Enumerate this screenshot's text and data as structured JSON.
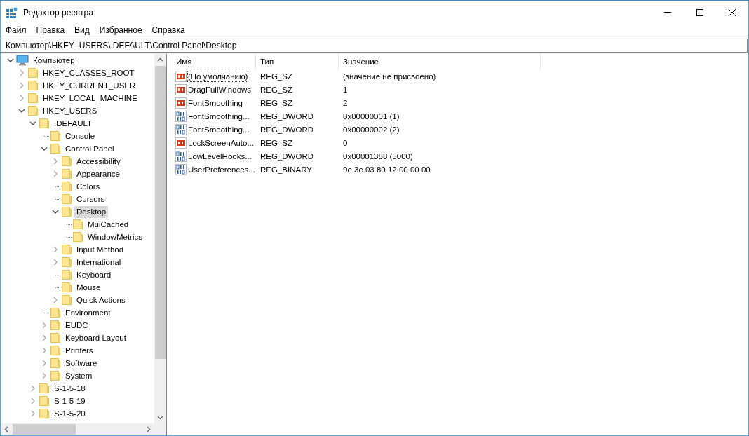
{
  "window": {
    "title": "Редактор реестра"
  },
  "menu": [
    "Файл",
    "Правка",
    "Вид",
    "Избранное",
    "Справка"
  ],
  "address": "Компьютер\\HKEY_USERS\\.DEFAULT\\Control Panel\\Desktop",
  "tree": {
    "name": "Компьютер",
    "expandable": true,
    "expanded": true,
    "selected": false,
    "children": [
      {
        "name": "HKEY_CLASSES_ROOT",
        "expandable": true,
        "expanded": false,
        "selected": false
      },
      {
        "name": "HKEY_CURRENT_USER",
        "expandable": true,
        "expanded": false,
        "selected": false
      },
      {
        "name": "HKEY_LOCAL_MACHINE",
        "expandable": true,
        "expanded": false,
        "selected": false
      },
      {
        "name": "HKEY_USERS",
        "expandable": true,
        "expanded": true,
        "selected": false,
        "children": [
          {
            "name": ".DEFAULT",
            "expandable": true,
            "expanded": true,
            "selected": false,
            "children": [
              {
                "name": "Console",
                "expandable": false,
                "selected": false
              },
              {
                "name": "Control Panel",
                "expandable": true,
                "expanded": true,
                "selected": false,
                "children": [
                  {
                    "name": "Accessibility",
                    "expandable": true,
                    "expanded": false,
                    "selected": false
                  },
                  {
                    "name": "Appearance",
                    "expandable": true,
                    "expanded": false,
                    "selected": false
                  },
                  {
                    "name": "Colors",
                    "expandable": false,
                    "selected": false
                  },
                  {
                    "name": "Cursors",
                    "expandable": false,
                    "selected": false
                  },
                  {
                    "name": "Desktop",
                    "expandable": true,
                    "expanded": true,
                    "selected": true,
                    "children": [
                      {
                        "name": "MuiCached",
                        "expandable": false,
                        "selected": false
                      },
                      {
                        "name": "WindowMetrics",
                        "expandable": false,
                        "selected": false
                      }
                    ]
                  },
                  {
                    "name": "Input Method",
                    "expandable": true,
                    "expanded": false,
                    "selected": false
                  },
                  {
                    "name": "International",
                    "expandable": true,
                    "expanded": false,
                    "selected": false
                  },
                  {
                    "name": "Keyboard",
                    "expandable": false,
                    "selected": false
                  },
                  {
                    "name": "Mouse",
                    "expandable": false,
                    "selected": false
                  },
                  {
                    "name": "Quick Actions",
                    "expandable": true,
                    "expanded": false,
                    "selected": false
                  }
                ]
              },
              {
                "name": "Environment",
                "expandable": false,
                "selected": false
              },
              {
                "name": "EUDC",
                "expandable": true,
                "expanded": false,
                "selected": false
              },
              {
                "name": "Keyboard Layout",
                "expandable": true,
                "expanded": false,
                "selected": false
              },
              {
                "name": "Printers",
                "expandable": true,
                "expanded": false,
                "selected": false
              },
              {
                "name": "Software",
                "expandable": true,
                "expanded": false,
                "selected": false
              },
              {
                "name": "System",
                "expandable": true,
                "expanded": false,
                "selected": false
              }
            ]
          },
          {
            "name": "S-1-5-18",
            "expandable": true,
            "expanded": false,
            "selected": false
          },
          {
            "name": "S-1-5-19",
            "expandable": true,
            "expanded": false,
            "selected": false
          },
          {
            "name": "S-1-5-20",
            "expandable": true,
            "expanded": false,
            "selected": false
          }
        ]
      }
    ]
  },
  "table": {
    "columns": [
      "Имя",
      "Тип",
      "Значение"
    ],
    "rows": [
      {
        "kind": "string",
        "name": "(По умолчанию)",
        "type": "REG_SZ",
        "value": "(значение не присвоено)",
        "focused": true
      },
      {
        "kind": "string",
        "name": "DragFullWindows",
        "type": "REG_SZ",
        "value": "1",
        "focused": false
      },
      {
        "kind": "string",
        "name": "FontSmoothing",
        "type": "REG_SZ",
        "value": "2",
        "focused": false
      },
      {
        "kind": "binary",
        "name": "FontSmoothing...",
        "type": "REG_DWORD",
        "value": "0x00000001 (1)",
        "focused": false
      },
      {
        "kind": "binary",
        "name": "FontSmoothing...",
        "type": "REG_DWORD",
        "value": "0x00000002 (2)",
        "focused": false
      },
      {
        "kind": "string",
        "name": "LockScreenAuto...",
        "type": "REG_SZ",
        "value": "0",
        "focused": false
      },
      {
        "kind": "binary",
        "name": "LowLevelHooks...",
        "type": "REG_DWORD",
        "value": "0x00001388 (5000)",
        "focused": false
      },
      {
        "kind": "binary",
        "name": "UserPreferences...",
        "type": "REG_BINARY",
        "value": "9e 3e 03 80 12 00 00 00",
        "focused": false
      }
    ]
  }
}
